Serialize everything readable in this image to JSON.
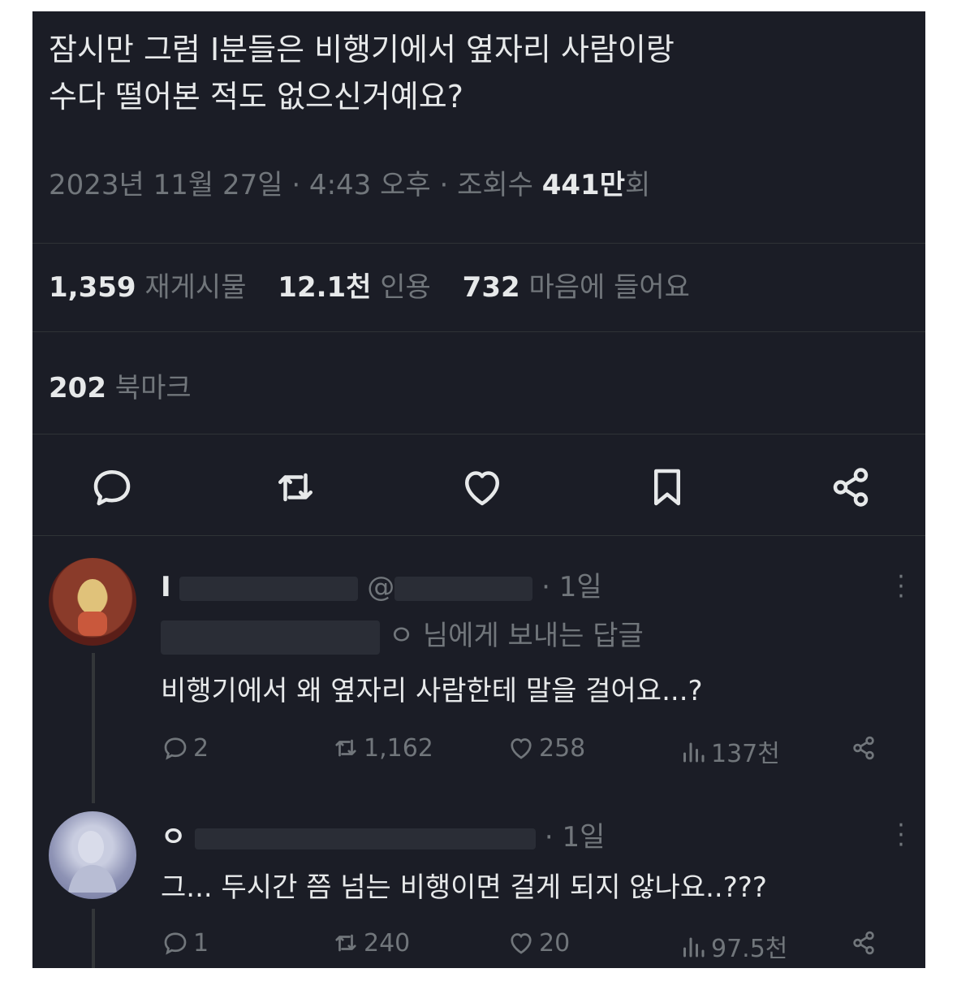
{
  "tweet": {
    "text_line1": "잠시만 그럼 I분들은 비행기에서 옆자리 사람이랑",
    "text_line2": "수다 떨어본 적도 없으신거예요?",
    "date": "2023년 11월 27일 · 4:43 오후 · 조회수 ",
    "views_value": "441만",
    "views_suffix": "회"
  },
  "stats": {
    "reposts_value": "1,359",
    "reposts_label": "재게시물",
    "quotes_value": "12.1천",
    "quotes_label": "인용",
    "likes_value": "732",
    "likes_label": "마음에 들어요",
    "bookmarks_value": "202",
    "bookmarks_label": "북마크"
  },
  "actions": [
    "reply-icon",
    "repost-icon",
    "like-icon",
    "bookmark-icon",
    "share-icon"
  ],
  "replies": [
    {
      "name_initial": "I",
      "handle_prefix": "@",
      "time": "· 1일",
      "replying_to_suffix": "ㅇ 님에게 보내는 답글",
      "text": "비행기에서 왜 옆자리 사람한테 말을 걸어요...?",
      "replies": "2",
      "reposts": "1,162",
      "likes": "258",
      "views": "137천"
    },
    {
      "name_initial": "ㅇ",
      "time": "· 1일",
      "text": "그... 두시간 쯤 넘는 비행이면 걸게 되지 않나요..???",
      "replies": "1",
      "reposts": "240",
      "likes": "20",
      "views": "97.5천"
    }
  ],
  "colors": {
    "background": "#1b1d26",
    "text_primary": "#e7e9ea",
    "text_secondary": "#71767b",
    "divider": "#2f3336"
  }
}
